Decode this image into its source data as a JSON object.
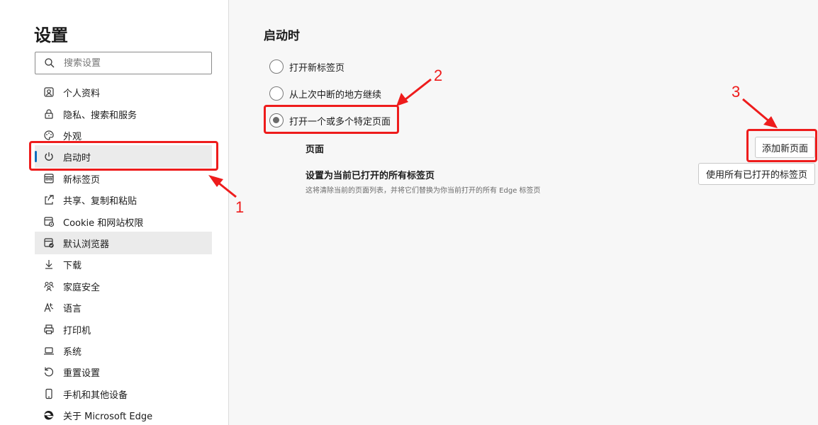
{
  "sidebar": {
    "title": "设置",
    "search_placeholder": "搜索设置",
    "items": [
      {
        "label": "个人资料",
        "icon": "profile-icon"
      },
      {
        "label": "隐私、搜索和服务",
        "icon": "lock-icon"
      },
      {
        "label": "外观",
        "icon": "palette-icon"
      },
      {
        "label": "启动时",
        "icon": "power-icon",
        "selected": true
      },
      {
        "label": "新标签页",
        "icon": "new-tab-icon"
      },
      {
        "label": "共享、复制和粘贴",
        "icon": "share-icon"
      },
      {
        "label": "Cookie 和网站权限",
        "icon": "site-permissions-icon"
      },
      {
        "label": "默认浏览器",
        "icon": "default-browser-icon"
      },
      {
        "label": "下载",
        "icon": "download-icon"
      },
      {
        "label": "家庭安全",
        "icon": "family-icon"
      },
      {
        "label": "语言",
        "icon": "language-icon"
      },
      {
        "label": "打印机",
        "icon": "printer-icon"
      },
      {
        "label": "系统",
        "icon": "laptop-icon"
      },
      {
        "label": "重置设置",
        "icon": "reset-icon"
      },
      {
        "label": "手机和其他设备",
        "icon": "phone-icon"
      },
      {
        "label": "关于 Microsoft Edge",
        "icon": "edge-logo-icon"
      }
    ]
  },
  "main": {
    "title": "启动时",
    "options": [
      {
        "label": "打开新标签页",
        "checked": false
      },
      {
        "label": "从上次中断的地方继续",
        "checked": false
      },
      {
        "label": "打开一个或多个特定页面",
        "checked": true
      }
    ],
    "pages_label": "页面",
    "add_page_button": "添加新页面",
    "set_current_title": "设置为当前已打开的所有标签页",
    "set_current_desc": "这将清除当前的页面列表，并将它们替换为你当前打开的所有 Edge 标签页",
    "use_open_tabs_button": "使用所有已打开的标签页"
  },
  "annotations": {
    "color": "#ee1c1c",
    "labels": [
      "1",
      "2",
      "3"
    ]
  },
  "colors": {
    "accent": "#0f6cbd",
    "selected_bg": "#ebebeb",
    "page_bg": "#f7f7f7"
  }
}
